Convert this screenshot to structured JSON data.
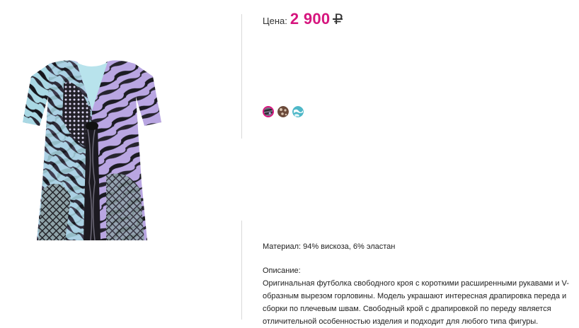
{
  "product": {
    "image_alt": "Футболка с принтом"
  },
  "price": {
    "label": "Цена:",
    "value": "2 900",
    "currency": "₽"
  },
  "swatches": [
    {
      "name": "purple-animal-print",
      "selected": true
    },
    {
      "name": "brown-animal-print",
      "selected": false
    },
    {
      "name": "turquoise-animal-print",
      "selected": false
    }
  ],
  "details": {
    "material": "Материал: 94% вискоза, 6% эластан",
    "description_heading": "Описание:",
    "description": "Оригинальная футболка свободного кроя с короткими  расширенными рукавами и V-образным вырезом горловины. Модель украшают интересная драпировка переда и сборки по плечевым швам. Свободный крой с драпировкой по переду является отличительной особенностью изделия и подходит для любого типа фигуры."
  },
  "colors": {
    "accent": "#d6157e",
    "divider": "#d9d9d9"
  }
}
